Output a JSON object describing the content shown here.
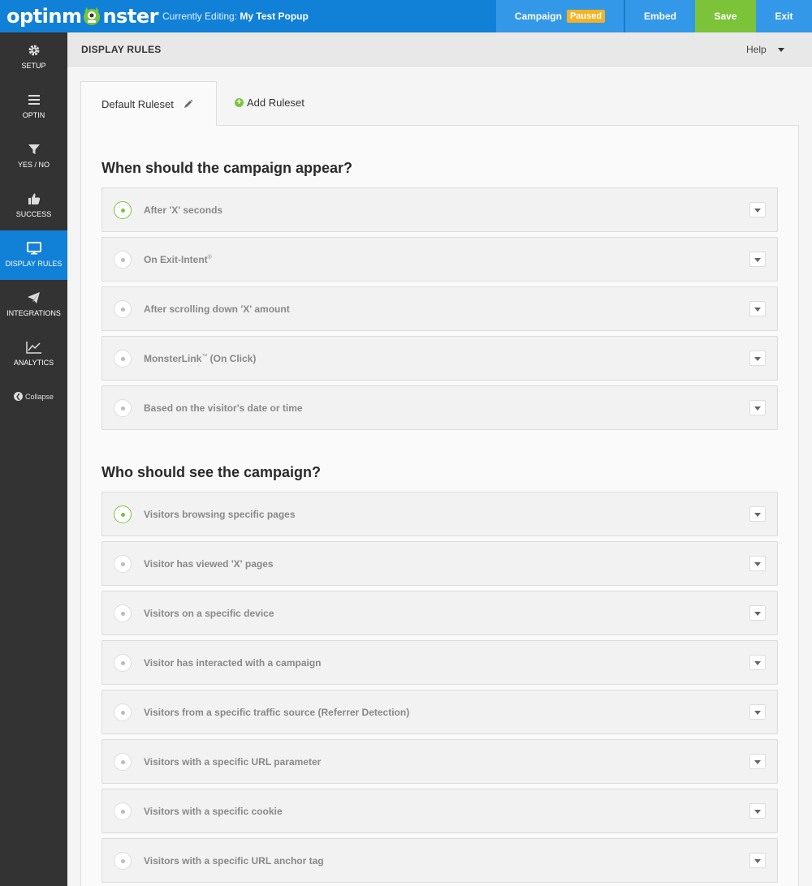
{
  "topbar": {
    "logo_text_a": "optinm",
    "logo_text_b": "nster",
    "editing_prefix": "Currently Editing:",
    "editing_name": "My Test Popup",
    "campaign_label": "Campaign",
    "campaign_status": "Paused",
    "embed_label": "Embed",
    "save_label": "Save",
    "exit_label": "Exit"
  },
  "sidebar": {
    "items": [
      {
        "label": "Setup",
        "icon": "gear-icon"
      },
      {
        "label": "Optin",
        "icon": "menu-icon"
      },
      {
        "label": "Yes / No",
        "icon": "filter-icon"
      },
      {
        "label": "Success",
        "icon": "thumbs-up-icon"
      },
      {
        "label": "Display Rules",
        "icon": "monitor-icon"
      },
      {
        "label": "Integrations",
        "icon": "paper-plane-icon"
      },
      {
        "label": "Analytics",
        "icon": "chart-icon"
      }
    ],
    "collapse_label": "Collapse"
  },
  "header": {
    "title": "DISPLAY RULES",
    "help_label": "Help"
  },
  "tabs": {
    "active_label": "Default Ruleset",
    "add_label": "Add Ruleset"
  },
  "sections": [
    {
      "title": "When should the campaign appear?",
      "rules": [
        {
          "label": "After 'X' seconds",
          "sup": "",
          "enabled": true
        },
        {
          "label": "On Exit-Intent",
          "sup": "®",
          "enabled": false
        },
        {
          "label": "After scrolling down 'X' amount",
          "sup": "",
          "enabled": false
        },
        {
          "label": "MonsterLink",
          "sup": "™",
          "suffix": " (On Click)",
          "enabled": false
        },
        {
          "label": "Based on the visitor's date or time",
          "sup": "",
          "enabled": false
        }
      ]
    },
    {
      "title": "Who should see the campaign?",
      "rules": [
        {
          "label": "Visitors browsing specific pages",
          "sup": "",
          "enabled": true
        },
        {
          "label": "Visitor has viewed 'X' pages",
          "sup": "",
          "enabled": false
        },
        {
          "label": "Visitors on a specific device",
          "sup": "",
          "enabled": false
        },
        {
          "label": "Visitor has interacted with a campaign",
          "sup": "",
          "enabled": false
        },
        {
          "label": "Visitors from a specific traffic source (Referrer Detection)",
          "sup": "",
          "enabled": false
        },
        {
          "label": "Visitors with a specific URL parameter",
          "sup": "",
          "enabled": false
        },
        {
          "label": "Visitors with a specific cookie",
          "sup": "",
          "enabled": false
        },
        {
          "label": "Visitors with a specific URL anchor tag",
          "sup": "",
          "enabled": false
        }
      ]
    }
  ],
  "colors": {
    "brand_blue": "#1180d7",
    "save_green": "#7cc33a",
    "paused_badge": "#f5b323",
    "sidebar_bg": "#333333"
  }
}
